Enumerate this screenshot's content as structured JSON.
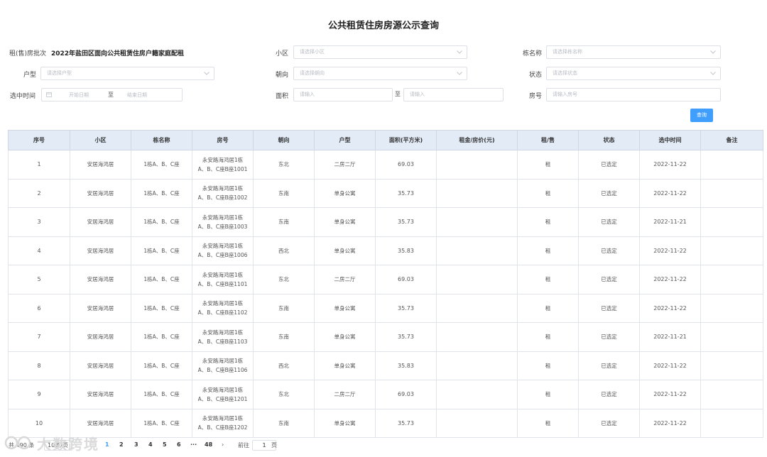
{
  "page": {
    "title": "公共租赁住房房源公示查询"
  },
  "form": {
    "batch_label": "租(售)房批次",
    "batch_value": "2022年盐田区面向公共租赁住房户籍家庭配租",
    "community_label": "小区",
    "community_placeholder": "请选择小区",
    "building_label": "栋名称",
    "building_placeholder": "请选择栋名称",
    "type_label": "户型",
    "type_placeholder": "请选择户型",
    "orientation_label": "朝向",
    "orientation_placeholder": "请选择朝向",
    "status_label": "状态",
    "status_placeholder": "请选择状态",
    "date_label": "选中时间",
    "date_start": "开始日期",
    "date_sep": "至",
    "date_end": "结束日期",
    "area_label": "面积",
    "area_min_placeholder": "请输入",
    "area_sep": "至",
    "area_max_placeholder": "请输入",
    "room_label": "房号",
    "room_placeholder": "请输入房号",
    "query_button": "查询"
  },
  "table": {
    "headers": [
      "序号",
      "小区",
      "栋名称",
      "房号",
      "朝向",
      "户型",
      "面积(平方米)",
      "租金/房价(元)",
      "租/售",
      "状态",
      "选中时间",
      "备注"
    ],
    "rows": [
      {
        "no": "1",
        "community": "安居海鸿居",
        "building": "1栋A、B、C座",
        "room_line1": "永安路海鸿居1栋",
        "room_line2": "A、B、C座B座1001",
        "orientation": "东北",
        "type": "二房二厅",
        "area": "69.03",
        "price": "",
        "mode": "租",
        "status": "已选定",
        "date": "2022-11-22",
        "note": ""
      },
      {
        "no": "2",
        "community": "安居海鸿居",
        "building": "1栋A、B、C座",
        "room_line1": "永安路海鸿居1栋",
        "room_line2": "A、B、C座B座1002",
        "orientation": "东南",
        "type": "单身公寓",
        "area": "35.73",
        "price": "",
        "mode": "租",
        "status": "已选定",
        "date": "2022-11-22",
        "note": ""
      },
      {
        "no": "3",
        "community": "安居海鸿居",
        "building": "1栋A、B、C座",
        "room_line1": "永安路海鸿居1栋",
        "room_line2": "A、B、C座B座1003",
        "orientation": "东南",
        "type": "单身公寓",
        "area": "35.73",
        "price": "",
        "mode": "租",
        "status": "已选定",
        "date": "2022-11-21",
        "note": ""
      },
      {
        "no": "4",
        "community": "安居海鸿居",
        "building": "1栋A、B、C座",
        "room_line1": "永安路海鸿居1栋",
        "room_line2": "A、B、C座B座1006",
        "orientation": "西北",
        "type": "单身公寓",
        "area": "35.83",
        "price": "",
        "mode": "租",
        "status": "已选定",
        "date": "2022-11-22",
        "note": ""
      },
      {
        "no": "5",
        "community": "安居海鸿居",
        "building": "1栋A、B、C座",
        "room_line1": "永安路海鸿居1栋",
        "room_line2": "A、B、C座B座1101",
        "orientation": "东北",
        "type": "二房二厅",
        "area": "69.03",
        "price": "",
        "mode": "租",
        "status": "已选定",
        "date": "2022-11-22",
        "note": ""
      },
      {
        "no": "6",
        "community": "安居海鸿居",
        "building": "1栋A、B、C座",
        "room_line1": "永安路海鸿居1栋",
        "room_line2": "A、B、C座B座1102",
        "orientation": "东南",
        "type": "单身公寓",
        "area": "35.73",
        "price": "",
        "mode": "租",
        "status": "已选定",
        "date": "2022-11-22",
        "note": ""
      },
      {
        "no": "7",
        "community": "安居海鸿居",
        "building": "1栋A、B、C座",
        "room_line1": "永安路海鸿居1栋",
        "room_line2": "A、B、C座B座1103",
        "orientation": "东南",
        "type": "单身公寓",
        "area": "35.73",
        "price": "",
        "mode": "租",
        "status": "已选定",
        "date": "2022-11-21",
        "note": ""
      },
      {
        "no": "8",
        "community": "安居海鸿居",
        "building": "1栋A、B、C座",
        "room_line1": "永安路海鸿居1栋",
        "room_line2": "A、B、C座B座1106",
        "orientation": "西北",
        "type": "单身公寓",
        "area": "35.83",
        "price": "",
        "mode": "租",
        "status": "已选定",
        "date": "2022-11-22",
        "note": ""
      },
      {
        "no": "9",
        "community": "安居海鸿居",
        "building": "1栋A、B、C座",
        "room_line1": "永安路海鸿居1栋",
        "room_line2": "A、B、C座B座1201",
        "orientation": "东北",
        "type": "二房二厅",
        "area": "69.03",
        "price": "",
        "mode": "租",
        "status": "已选定",
        "date": "2022-11-22",
        "note": ""
      },
      {
        "no": "10",
        "community": "安居海鸿居",
        "building": "1栋A、B、C座",
        "room_line1": "永安路海鸿居1栋",
        "room_line2": "A、B、C座B座1202",
        "orientation": "东南",
        "type": "单身公寓",
        "area": "35.73",
        "price": "",
        "mode": "租",
        "status": "已选定",
        "date": "2022-11-22",
        "note": ""
      }
    ]
  },
  "pagination": {
    "total": "共 490 条",
    "page_size": "10条/页",
    "pages": [
      "1",
      "2",
      "3",
      "4",
      "5",
      "6"
    ],
    "ellipsis": "···",
    "last_page": "48",
    "next": "›",
    "goto_label": "前往",
    "goto_value": "1",
    "goto_suffix": "页"
  },
  "watermark": {
    "text": "大数跨境"
  },
  "colors": {
    "accent": "#409eff",
    "header_bg": "#e3ebf7"
  }
}
